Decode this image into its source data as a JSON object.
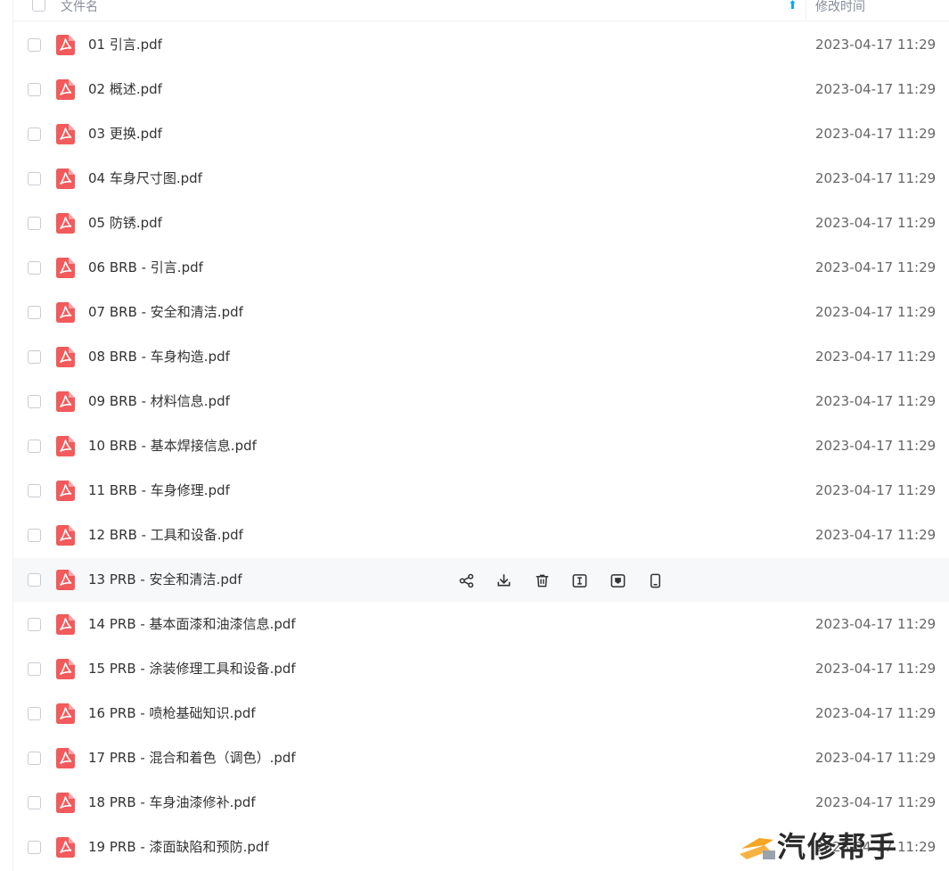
{
  "header": {
    "name_label": "文件名",
    "sort_icon": "arrow-up-icon",
    "time_label": "修改时间"
  },
  "rows": [
    {
      "name": "01 引言.pdf",
      "time": "2023-04-17 11:29"
    },
    {
      "name": "02 概述.pdf",
      "time": "2023-04-17 11:29"
    },
    {
      "name": "03 更换.pdf",
      "time": "2023-04-17 11:29"
    },
    {
      "name": "04 车身尺寸图.pdf",
      "time": "2023-04-17 11:29"
    },
    {
      "name": "05 防锈.pdf",
      "time": "2023-04-17 11:29"
    },
    {
      "name": "06 BRB - 引言.pdf",
      "time": "2023-04-17 11:29"
    },
    {
      "name": "07 BRB - 安全和清洁.pdf",
      "time": "2023-04-17 11:29"
    },
    {
      "name": "08 BRB - 车身构造.pdf",
      "time": "2023-04-17 11:29"
    },
    {
      "name": "09 BRB - 材料信息.pdf",
      "time": "2023-04-17 11:29"
    },
    {
      "name": "10 BRB - 基本焊接信息.pdf",
      "time": "2023-04-17 11:29"
    },
    {
      "name": "11 BRB - 车身修理.pdf",
      "time": "2023-04-17 11:29"
    },
    {
      "name": "12 BRB - 工具和设备.pdf",
      "time": "2023-04-17 11:29"
    },
    {
      "name": "13 PRB - 安全和清洁.pdf",
      "time": ""
    },
    {
      "name": "14 PRB - 基本面漆和油漆信息.pdf",
      "time": "2023-04-17 11:29"
    },
    {
      "name": "15 PRB - 涂装修理工具和设备.pdf",
      "time": "2023-04-17 11:29"
    },
    {
      "name": "16 PRB - 喷枪基础知识.pdf",
      "time": "2023-04-17 11:29"
    },
    {
      "name": "17 PRB - 混合和着色（调色）.pdf",
      "time": "2023-04-17 11:29"
    },
    {
      "name": "18 PRB - 车身油漆修补.pdf",
      "time": "2023-04-17 11:29"
    },
    {
      "name": "19 PRB - 漆面缺陷和预防.pdf",
      "time": "2023-04-17 11:29"
    }
  ],
  "hover_actions": [
    "share-icon",
    "download-icon",
    "trash-icon",
    "rename-icon",
    "collect-icon",
    "mobile-icon"
  ],
  "watermark": {
    "text": "汽修帮手"
  },
  "colors": {
    "accent": "#06a7ff",
    "pdf_red": "#f25a5c",
    "row_hover": "#f7f8fa"
  }
}
